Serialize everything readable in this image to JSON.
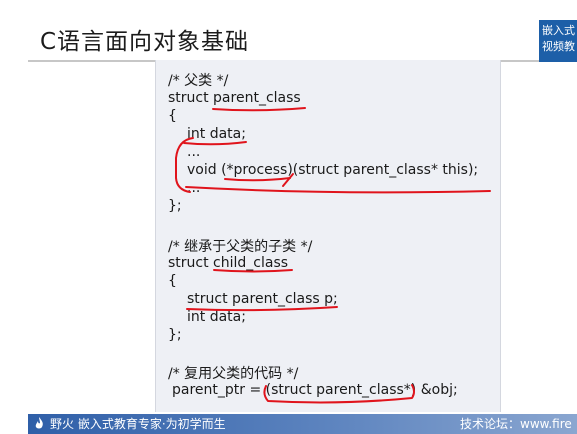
{
  "slide": {
    "title": "C语言面向对象基础",
    "badge_line1": "嵌入式",
    "badge_line2": "视频教"
  },
  "code": {
    "lines": [
      "/* 父类 */",
      "struct parent_class",
      "{",
      "int data;",
      "...",
      "void (*process)(struct parent_class* this);",
      "...",
      "};",
      "/* 继承于父类的子类 */",
      "struct child_class",
      "{",
      "struct parent_class p;",
      "int data;",
      "};",
      "/* 复用父类的代码 */",
      "parent_ptr = (struct parent_class*) &obj;"
    ]
  },
  "footer": {
    "left_text": "野火 嵌入式教育专家·为初学而生",
    "right_text": "技术论坛：www.fire"
  },
  "colors": {
    "annotation": "#e0141c",
    "brand_blue": "#2f5fa8"
  }
}
